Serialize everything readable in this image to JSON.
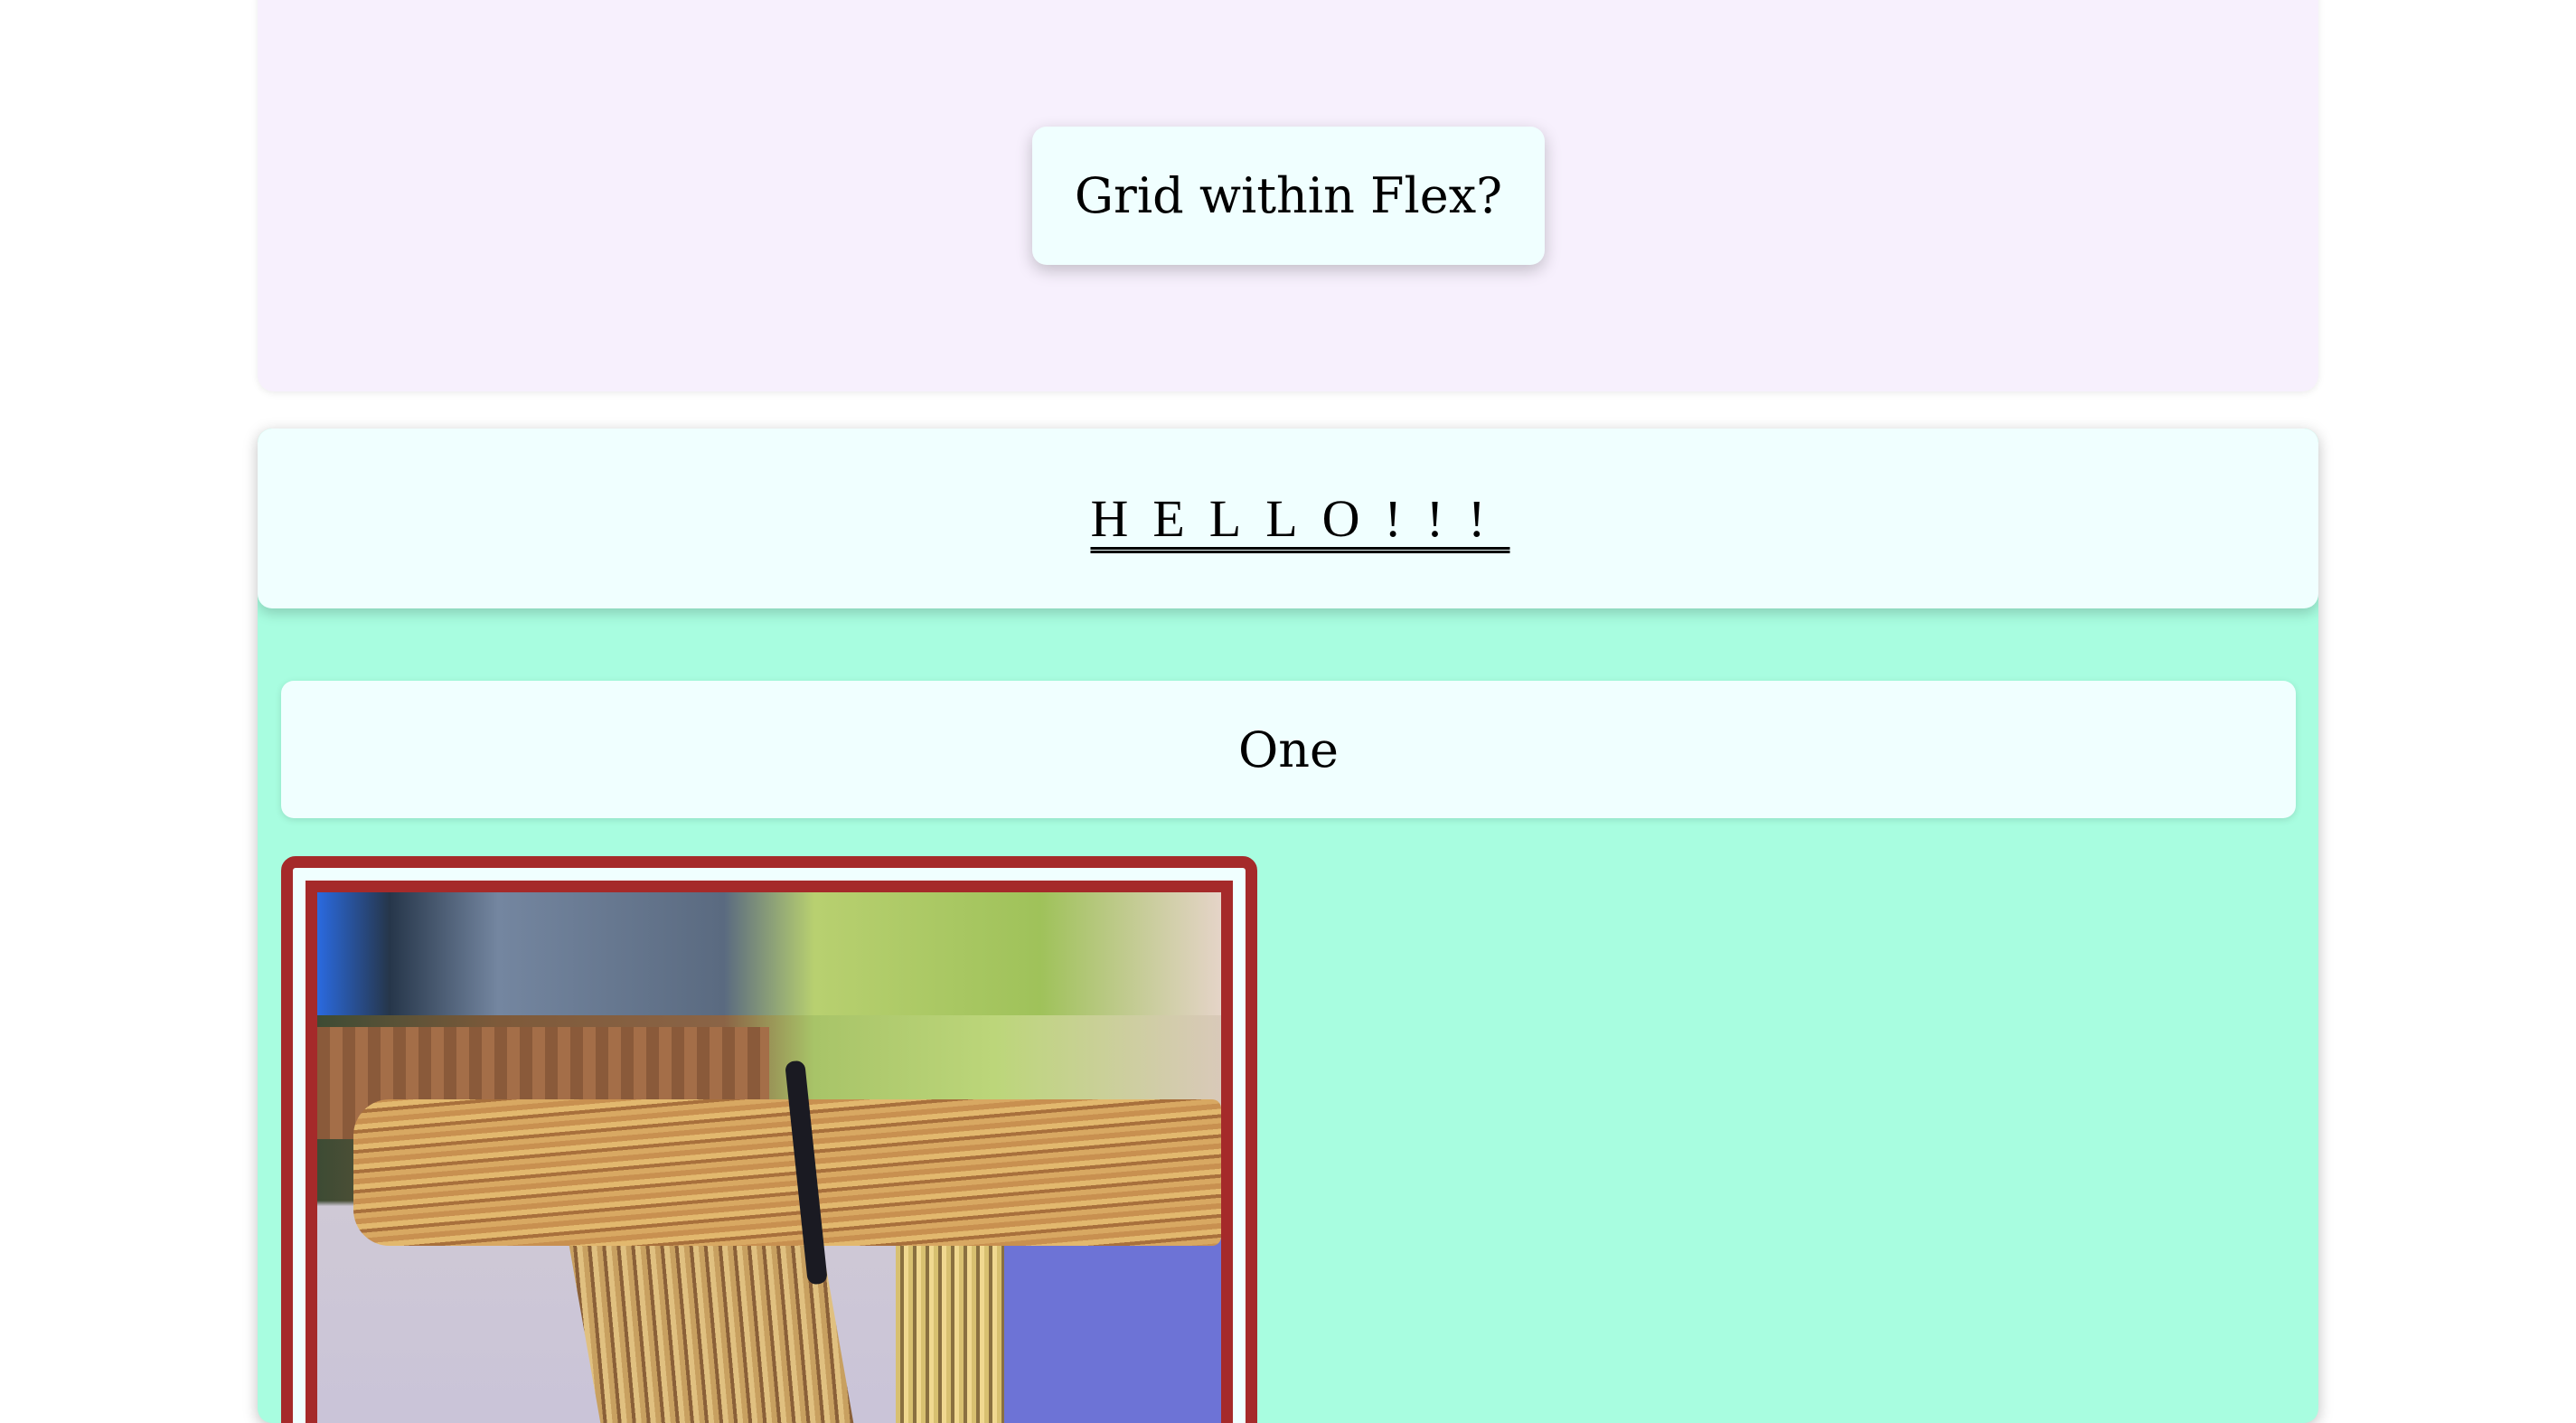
{
  "top": {
    "title": "Grid within Flex?"
  },
  "section": {
    "heading": "HELLO!!!",
    "cards": [
      {
        "label": "One"
      }
    ]
  },
  "colors": {
    "top_bg": "#f7f0fd",
    "card_bg": "#f0ffff",
    "section_bg": "#a8fde0",
    "frame_border": "#a52a2a"
  }
}
